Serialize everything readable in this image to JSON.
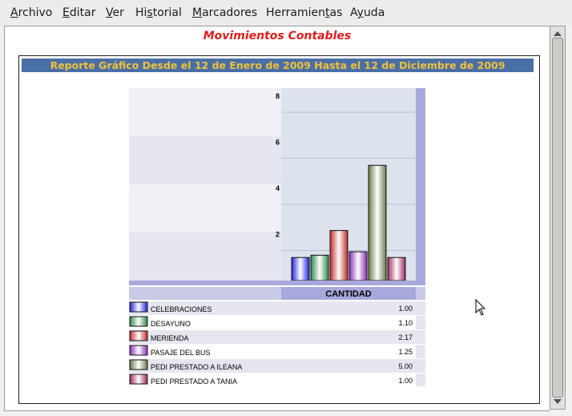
{
  "menu": {
    "items": [
      {
        "label": "Archivo",
        "u": "A",
        "rest": "rchivo"
      },
      {
        "label": "Editar",
        "u": "E",
        "rest": "ditar"
      },
      {
        "label": "Ver",
        "u": "V",
        "rest": "er"
      },
      {
        "label": "Historial",
        "pre": "Hi",
        "u": "s",
        "rest": "torial"
      },
      {
        "label": "Marcadores",
        "u": "M",
        "rest": "arcadores"
      },
      {
        "label": "Herramientas",
        "pre": "Herramien",
        "u": "t",
        "rest": "as"
      },
      {
        "label": "Ayuda",
        "pre": "A",
        "u": "y",
        "rest": "uda"
      }
    ]
  },
  "page": {
    "title": "Movimientos Contables",
    "banner": "Reporte Gráfico Desde el 12 de Enero de 2009 Hasta el 12 de Diciembre de 2009"
  },
  "colors": {
    "title": "#dd1c1c",
    "banner_bg": "#4a6fa7",
    "banner_text": "#f0c238"
  },
  "chart_data": {
    "type": "bar",
    "categories": [
      "CELEBRACIONES",
      "DESAYUNO",
      "MERIENDA",
      "PASAJE DEL BUS",
      "PEDI PRESTADO A ILEANA",
      "PEDI PRESTADO A TANIA"
    ],
    "values": [
      1.0,
      1.1,
      2.17,
      1.25,
      5.0,
      1.0
    ],
    "value_labels": [
      "1.00",
      "1.10",
      "2.17",
      "1.25",
      "5.00",
      "1.00"
    ],
    "colors": [
      "#2323e0",
      "#2f8a46",
      "#c42a2a",
      "#8a2fb8",
      "#6b7a48",
      "#9c2a63"
    ],
    "yticks": [
      "2",
      "4",
      "6",
      "8"
    ],
    "ylim": [
      0,
      8
    ],
    "table_header": "CANTIDAD",
    "legend": "table-below",
    "grid": true
  }
}
